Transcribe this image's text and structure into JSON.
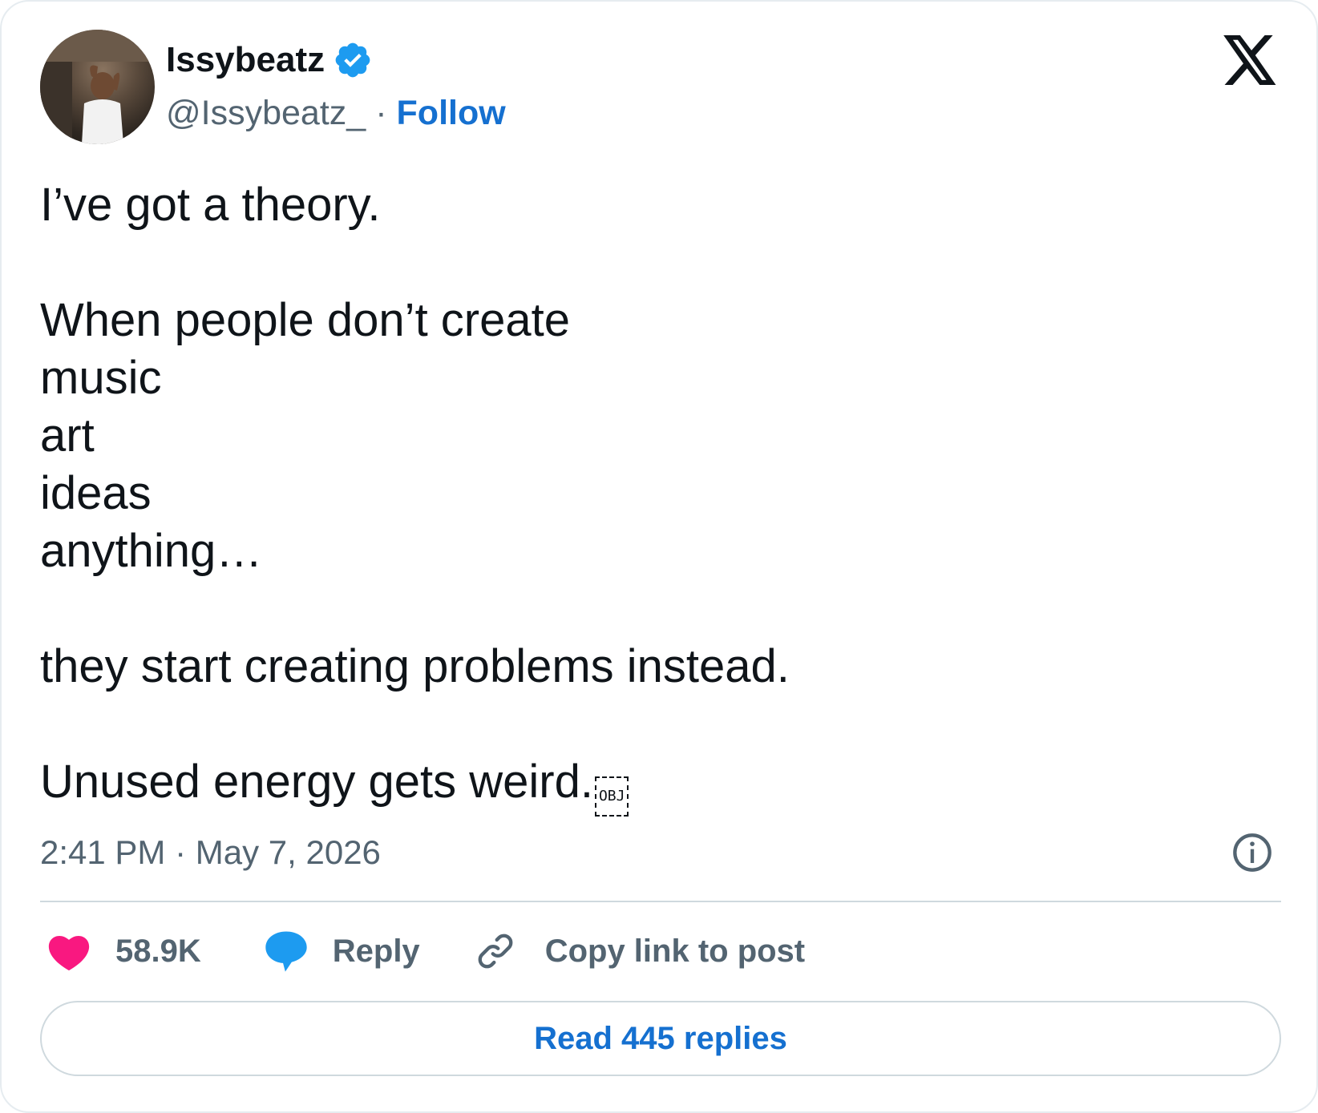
{
  "author": {
    "name": "Issybeatz",
    "handle": "@Issybeatz_",
    "separator": "·",
    "follow_label": "Follow",
    "verified": true
  },
  "icons": {
    "brand": "x-logo-icon",
    "verified": "verified-badge-icon",
    "info": "info-icon",
    "like": "heart-icon",
    "reply": "reply-bubble-icon",
    "copy": "link-icon"
  },
  "tweet": {
    "lines": [
      "I’ve got a theory.",
      "",
      "When people don’t create",
      "music",
      "art",
      "ideas",
      "anything…",
      "",
      "they start creating problems instead.",
      "",
      "Unused energy gets weird."
    ],
    "trailing_glyph": "OBJ"
  },
  "meta": {
    "time": "2:41 PM",
    "separator": "·",
    "date": "May 7, 2026"
  },
  "actions": {
    "likes": "58.9K",
    "reply_label": "Reply",
    "copy_label": "Copy link to post"
  },
  "read_replies_label": "Read 445 replies",
  "colors": {
    "text": "#0f1419",
    "secondary": "#536471",
    "link": "#1570d0",
    "verified": "#1d9bf0",
    "like": "#f91880",
    "reply": "#1d9bf0",
    "border": "#cfd9de"
  }
}
